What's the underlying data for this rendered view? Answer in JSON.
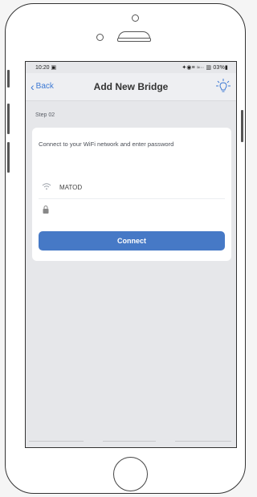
{
  "status_bar": {
    "time": "10:20",
    "time_suffix": "▣",
    "right_icons": "✦◉≡ ≈·· ▥ 03%▮"
  },
  "nav": {
    "back_label": "Back",
    "title": "Add New Bridge",
    "bulb_icon": "lightbulb-icon"
  },
  "step_label": "Step 02",
  "card": {
    "prompt": "Connect to your WiFi network and enter password",
    "network_name": "MATOD",
    "password_value": "",
    "password_placeholder": "",
    "connect_label": "Connect"
  },
  "colors": {
    "accent": "#3d79d4",
    "button": "#4679c6",
    "screen_bg": "#e6e7ea"
  }
}
